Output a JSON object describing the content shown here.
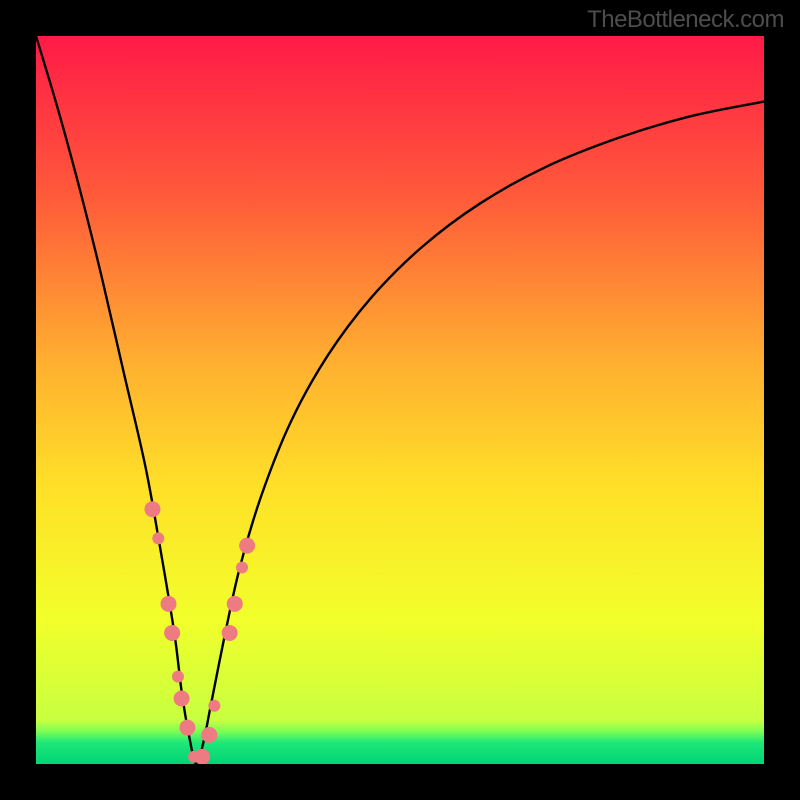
{
  "watermark": "TheBottleneck.com",
  "chart_data": {
    "type": "line",
    "title": "",
    "xlabel": "",
    "ylabel": "",
    "xlim": [
      0,
      100
    ],
    "ylim": [
      0,
      100
    ],
    "optimum_x": 22,
    "gradient_stops": [
      {
        "offset": 0,
        "color": "#ff1a47"
      },
      {
        "offset": 0.22,
        "color": "#ff5a3a"
      },
      {
        "offset": 0.45,
        "color": "#ffb030"
      },
      {
        "offset": 0.62,
        "color": "#ffe028"
      },
      {
        "offset": 0.8,
        "color": "#f2ff2a"
      },
      {
        "offset": 0.94,
        "color": "#c8ff40"
      },
      {
        "offset": 0.955,
        "color": "#7dff55"
      },
      {
        "offset": 0.97,
        "color": "#20e878"
      },
      {
        "offset": 1.0,
        "color": "#00d478"
      }
    ],
    "curve": {
      "description": "V-shaped bottleneck curve; minimum near x≈22, rising steeply left, asymptotically right",
      "x": [
        0,
        3,
        6,
        9,
        12,
        15,
        17,
        19,
        20,
        21,
        22,
        23,
        24,
        26,
        28,
        31,
        35,
        40,
        46,
        53,
        61,
        70,
        80,
        90,
        100
      ],
      "y": [
        100,
        90,
        79,
        67,
        54,
        41,
        30,
        18,
        10,
        4,
        0,
        3,
        8,
        18,
        27,
        37,
        47,
        56,
        64,
        71,
        77,
        82,
        86,
        89,
        91
      ]
    },
    "markers": {
      "color": "#ed7b81",
      "radius_main": 8,
      "radius_small": 6,
      "points": [
        {
          "x": 16.0,
          "y": 35
        },
        {
          "x": 16.8,
          "y": 31
        },
        {
          "x": 18.2,
          "y": 22
        },
        {
          "x": 18.7,
          "y": 18
        },
        {
          "x": 19.5,
          "y": 12
        },
        {
          "x": 20.0,
          "y": 9
        },
        {
          "x": 20.8,
          "y": 5
        },
        {
          "x": 21.7,
          "y": 1
        },
        {
          "x": 22.8,
          "y": 1
        },
        {
          "x": 23.8,
          "y": 4
        },
        {
          "x": 24.5,
          "y": 8
        },
        {
          "x": 26.6,
          "y": 18
        },
        {
          "x": 27.3,
          "y": 22
        },
        {
          "x": 28.3,
          "y": 27
        },
        {
          "x": 29.0,
          "y": 30
        }
      ]
    }
  }
}
